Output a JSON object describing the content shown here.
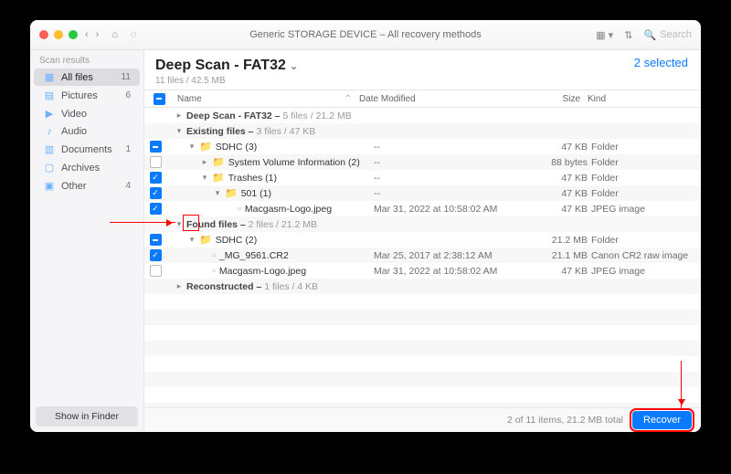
{
  "titlebar": {
    "title": "Generic STORAGE DEVICE – All recovery methods",
    "search_placeholder": "Search"
  },
  "sidebar": {
    "header": "Scan results",
    "items": [
      {
        "icon": "▦",
        "label": "All files",
        "count": "11",
        "active": true
      },
      {
        "icon": "▤",
        "label": "Pictures",
        "count": "6"
      },
      {
        "icon": "▶",
        "label": "Video",
        "count": ""
      },
      {
        "icon": "♪",
        "label": "Audio",
        "count": ""
      },
      {
        "icon": "▥",
        "label": "Documents",
        "count": "1"
      },
      {
        "icon": "▢",
        "label": "Archives",
        "count": ""
      },
      {
        "icon": "▣",
        "label": "Other",
        "count": "4"
      }
    ],
    "footer": "Show in Finder"
  },
  "main": {
    "title": "Deep Scan - FAT32",
    "subtitle": "11 files / 42.5 MB",
    "selected": "2 selected"
  },
  "columns": {
    "name": "Name",
    "date": "Date Modified",
    "size": "Size",
    "kind": "Kind"
  },
  "rows": [
    {
      "type": "group",
      "disc": "▸",
      "indent": 0,
      "chk": "none",
      "label": "Deep Scan - FAT32 – ",
      "meta": "5 files / 21.2 MB"
    },
    {
      "type": "group",
      "disc": "▾",
      "indent": 0,
      "chk": "none",
      "label": "Existing files – ",
      "meta": "3 files / 47 KB"
    },
    {
      "type": "folder",
      "disc": "▾",
      "indent": 1,
      "chk": "mixed",
      "label": "SDHC (3)",
      "date": "--",
      "size": "47 KB",
      "kind": "Folder"
    },
    {
      "type": "folder",
      "disc": "▸",
      "indent": 2,
      "chk": "off",
      "label": "System Volume Information (2)",
      "date": "--",
      "size": "88 bytes",
      "kind": "Folder"
    },
    {
      "type": "folder",
      "disc": "▾",
      "indent": 2,
      "chk": "on",
      "label": "Trashes (1)",
      "date": "--",
      "size": "47 KB",
      "kind": "Folder"
    },
    {
      "type": "folder",
      "disc": "▾",
      "indent": 3,
      "chk": "on",
      "label": "501 (1)",
      "date": "--",
      "size": "47 KB",
      "kind": "Folder"
    },
    {
      "type": "file",
      "disc": "",
      "indent": 4,
      "chk": "on",
      "label": "Macgasm-Logo.jpeg",
      "date": "Mar 31, 2022 at 10:58:02 AM",
      "size": "47 KB",
      "kind": "JPEG image",
      "highlight": true
    },
    {
      "type": "group",
      "disc": "▾",
      "indent": 0,
      "chk": "none",
      "label": "Found files – ",
      "meta": "2 files / 21.2 MB"
    },
    {
      "type": "folder",
      "disc": "▾",
      "indent": 1,
      "chk": "mixed",
      "label": "SDHC (2)",
      "date": "",
      "size": "21.2 MB",
      "kind": "Folder"
    },
    {
      "type": "file",
      "disc": "",
      "indent": 2,
      "chk": "on",
      "label": "_MG_9561.CR2",
      "date": "Mar 25, 2017 at 2:38:12 AM",
      "size": "21.1 MB",
      "kind": "Canon CR2 raw image"
    },
    {
      "type": "file",
      "disc": "",
      "indent": 2,
      "chk": "off",
      "label": "Macgasm-Logo.jpeg",
      "date": "Mar 31, 2022 at 10:58:02 AM",
      "size": "47 KB",
      "kind": "JPEG image"
    },
    {
      "type": "group",
      "disc": "▸",
      "indent": 0,
      "chk": "none",
      "label": "Reconstructed – ",
      "meta": "1 files / 4 KB"
    }
  ],
  "footer": {
    "status": "2 of 11 items, 21.2 MB total",
    "recover": "Recover"
  }
}
